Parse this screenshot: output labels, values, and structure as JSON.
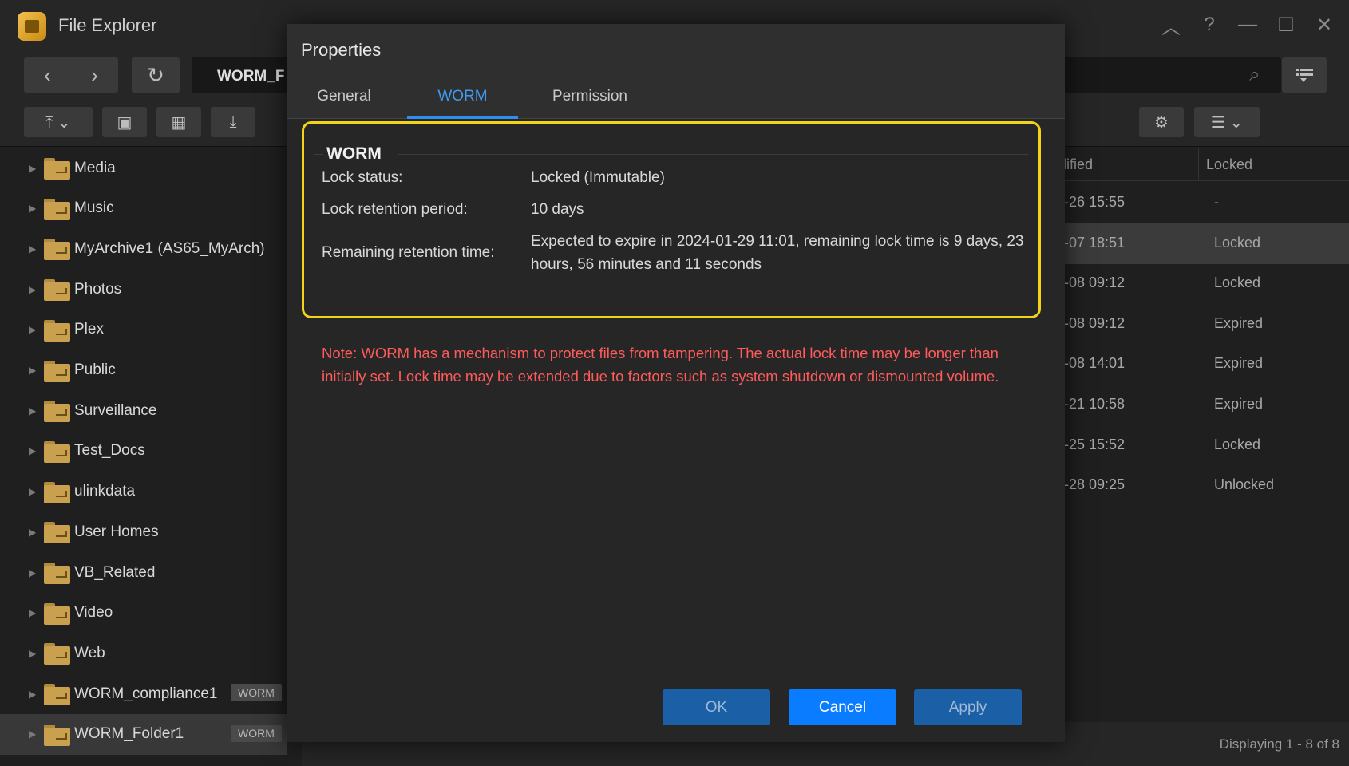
{
  "app": {
    "title": "File Explorer"
  },
  "path": {
    "text": "WORM_F"
  },
  "sidebar": {
    "items": [
      {
        "label": "Media"
      },
      {
        "label": "Music"
      },
      {
        "label": "MyArchive1 (AS65_MyArch)"
      },
      {
        "label": "Photos"
      },
      {
        "label": "Plex"
      },
      {
        "label": "Public"
      },
      {
        "label": "Surveillance"
      },
      {
        "label": "Test_Docs"
      },
      {
        "label": "ulinkdata"
      },
      {
        "label": "User Homes"
      },
      {
        "label": "VB_Related"
      },
      {
        "label": "Video"
      },
      {
        "label": "Web"
      },
      {
        "label": "WORM_compliance1",
        "badge": "WORM"
      },
      {
        "label": "WORM_Folder1",
        "badge": "WORM"
      }
    ]
  },
  "list": {
    "columns": {
      "modified": "dified",
      "locked": "Locked"
    },
    "rows": [
      {
        "modified": "-26 15:55",
        "locked": "-"
      },
      {
        "modified": "-07 18:51",
        "locked": "Locked"
      },
      {
        "modified": "-08 09:12",
        "locked": "Locked"
      },
      {
        "modified": "-08 09:12",
        "locked": "Expired"
      },
      {
        "modified": "-08 14:01",
        "locked": "Expired"
      },
      {
        "modified": "-21 10:58",
        "locked": "Expired"
      },
      {
        "modified": "-25 15:52",
        "locked": "Locked"
      },
      {
        "modified": "-28 09:25",
        "locked": "Unlocked"
      }
    ],
    "status": "Displaying 1 - 8 of 8"
  },
  "dialog": {
    "title": "Properties",
    "tabs": [
      {
        "label": "General"
      },
      {
        "label": "WORM"
      },
      {
        "label": "Permission"
      }
    ],
    "worm": {
      "section_title": "WORM",
      "lock_status_label": "Lock status:",
      "lock_status_value": "Locked (Immutable)",
      "retention_label": "Lock retention period:",
      "retention_value": "10 days",
      "remaining_label": "Remaining retention time:",
      "remaining_value": "Expected to expire in 2024-01-29 11:01, remaining lock time is 9 days, 23 hours, 56 minutes and 11 seconds"
    },
    "note": "Note: WORM has a mechanism to protect files from tampering. The actual lock time may be longer than initially set. Lock time may be extended due to factors such as system shutdown or dismounted volume.",
    "buttons": {
      "ok": "OK",
      "cancel": "Cancel",
      "apply": "Apply"
    }
  }
}
